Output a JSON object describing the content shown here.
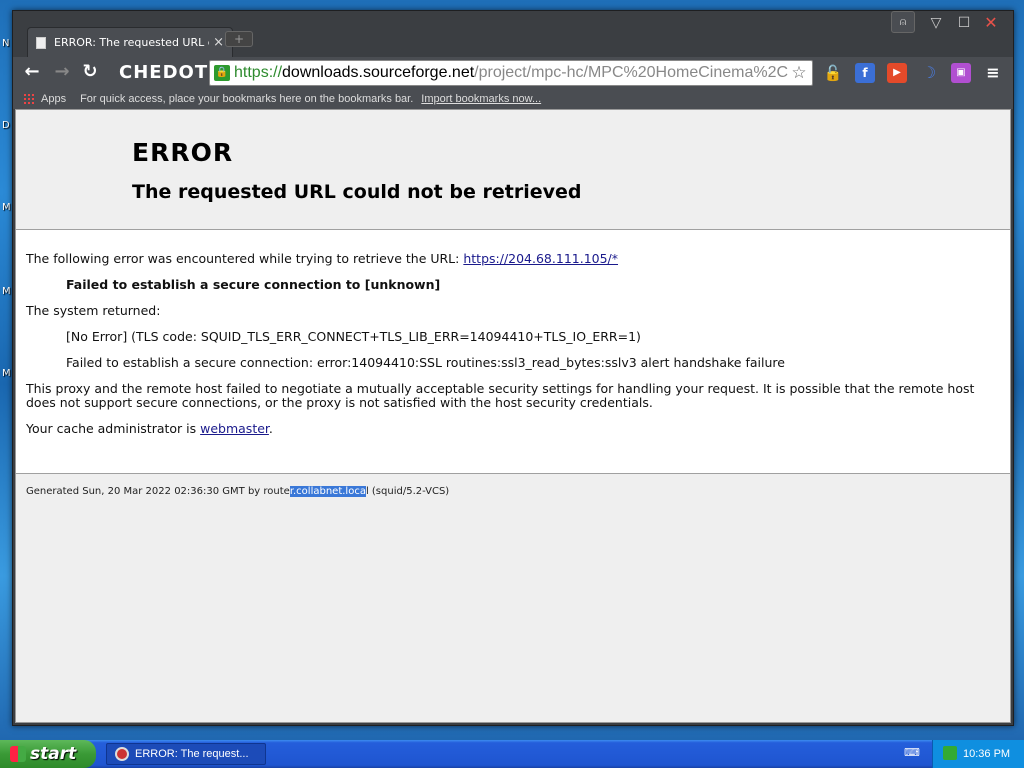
{
  "desktop": {
    "edge_letters": [
      "N",
      "D",
      "M",
      "M",
      "M"
    ]
  },
  "window": {
    "tab": {
      "title": "ERROR: The requested URL c",
      "close": "×"
    },
    "new_tab": "+",
    "controls": {
      "profile": "⍝",
      "minimize": "▽",
      "maximize": "☐",
      "close": "✕"
    }
  },
  "toolbar": {
    "back": "←",
    "forward": "→",
    "reload": "↻",
    "brand": "CHEDOT",
    "url": {
      "scheme": "https://",
      "host": "downloads.sourceforge.net",
      "path": "/project/mpc-hc/MPC%20HomeCinema%2C"
    },
    "star": "☆",
    "extensions": {
      "lock": "🔓",
      "facebook": "f",
      "youtube": "▶",
      "moon": "☽",
      "tv": "▣",
      "menu": "≡"
    }
  },
  "bookmarks": {
    "apps": "Apps",
    "hint": "For quick access, place your bookmarks here on the bookmarks bar.",
    "import": "Import bookmarks now..."
  },
  "error_page": {
    "title": "ERROR",
    "subtitle": "The requested URL could not be retrieved",
    "intro": "The following error was encountered while trying to retrieve the URL: ",
    "intro_link": "https://204.68.111.105/*",
    "failure": "Failed to establish a secure connection to [unknown]",
    "system_returned": "The system returned:",
    "no_error": "[No Error] (TLS code: SQUID_TLS_ERR_CONNECT+TLS_LIB_ERR=14094410+TLS_IO_ERR=1)",
    "ssl_error": "Failed to establish a secure connection: error:14094410:SSL routines:ssl3_read_bytes:sslv3 alert handshake failure",
    "explanation": "This proxy and the remote host failed to negotiate a mutually acceptable security settings for handling your request. It is possible that the remote host does not support secure connections, or the proxy is not satisfied with the host security credentials.",
    "admin_prefix": "Your cache administrator is ",
    "admin_link": "webmaster",
    "admin_suffix": ".",
    "footer_prefix": "Generated Sun, 20 Mar 2022 02:36:30 GMT by route",
    "footer_selected": "r.collabnet.loca",
    "footer_suffix": "l (squid/5.2-VCS)"
  },
  "taskbar": {
    "start": "start",
    "task": "ERROR: The request...",
    "keyboard": "⌨",
    "clock": "10:36 PM"
  }
}
